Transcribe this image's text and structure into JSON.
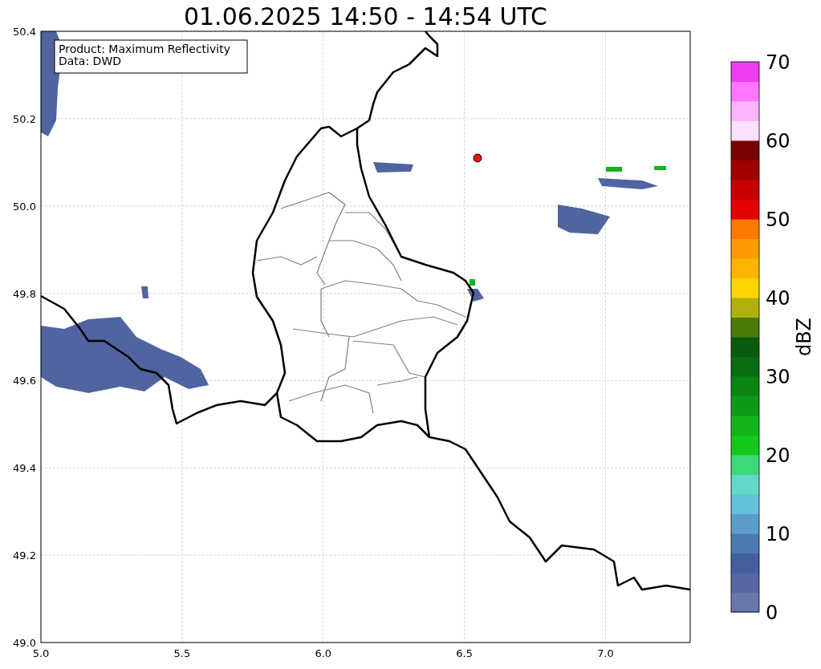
{
  "title": "01.06.2025 14:50 - 14:54 UTC",
  "info_box": [
    "Product: Maximum Reflectivity",
    "Data: DWD"
  ],
  "map": {
    "x_ticks": [
      "5.0",
      "5.5",
      "6.0",
      "6.5",
      "7.0"
    ],
    "y_ticks": [
      "50.4",
      "50.2",
      "50.0",
      "49.8",
      "49.6",
      "49.4",
      "49.2",
      "49.0"
    ]
  },
  "colorbar": {
    "label": "dBZ",
    "ticks": [
      "70",
      "60",
      "50",
      "40",
      "30",
      "20",
      "10",
      "0"
    ],
    "bins": [
      {
        "color": "#6677aa"
      },
      {
        "color": "#56689f"
      },
      {
        "color": "#4560a0"
      },
      {
        "color": "#4a7ab0"
      },
      {
        "color": "#5a9ec8"
      },
      {
        "color": "#62c0d8"
      },
      {
        "color": "#62d8c8"
      },
      {
        "color": "#3cd87a"
      },
      {
        "color": "#14c81e"
      },
      {
        "color": "#12b41a"
      },
      {
        "color": "#0e9a16"
      },
      {
        "color": "#0c8414"
      },
      {
        "color": "#0a6c12"
      },
      {
        "color": "#0a5a10"
      },
      {
        "color": "#4a7a0a"
      },
      {
        "color": "#b0b00a"
      },
      {
        "color": "#ffd400"
      },
      {
        "color": "#ffb400"
      },
      {
        "color": "#ff9a00"
      },
      {
        "color": "#ff7800"
      },
      {
        "color": "#e60000"
      },
      {
        "color": "#c80000"
      },
      {
        "color": "#a00000"
      },
      {
        "color": "#7a0000"
      },
      {
        "color": "#ffe0ff"
      },
      {
        "color": "#ffb4ff"
      },
      {
        "color": "#ff78ff"
      },
      {
        "color": "#f03cf0"
      }
    ]
  }
}
